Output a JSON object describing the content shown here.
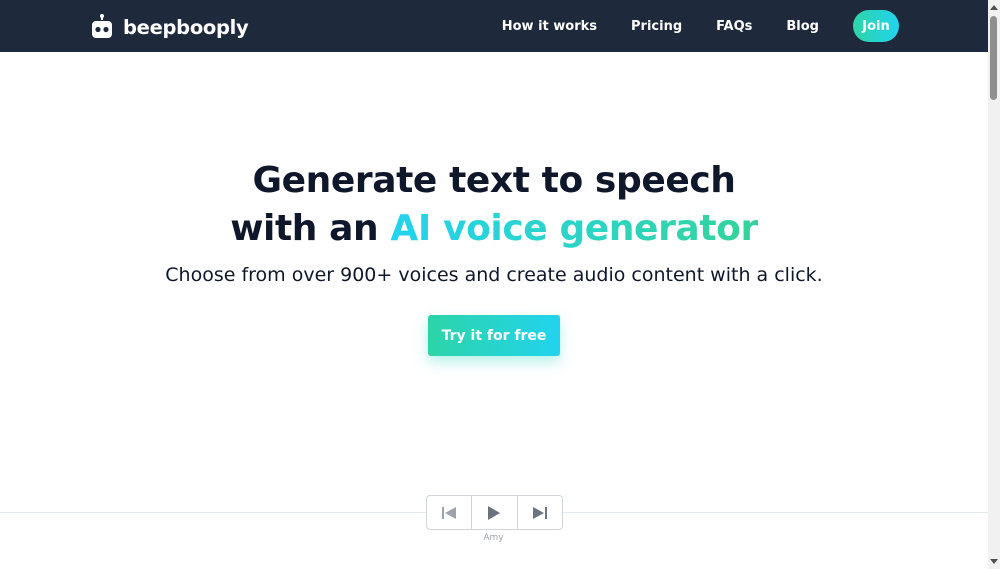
{
  "brand": {
    "name": "beepbooply"
  },
  "nav": {
    "links": [
      {
        "label": "How it works"
      },
      {
        "label": "Pricing"
      },
      {
        "label": "FAQs"
      },
      {
        "label": "Blog"
      }
    ],
    "join_label": "Join"
  },
  "hero": {
    "title_line1": "Generate text to speech",
    "title_line2_prefix": "with an ",
    "title_line2_highlight": "AI voice generator",
    "subtitle": "Choose from over 900+ voices and create audio content with a click.",
    "cta_label": "Try it for free"
  },
  "player": {
    "voice_name": "Amy",
    "controls": [
      {
        "icon": "skip-back-icon"
      },
      {
        "icon": "play-icon"
      },
      {
        "icon": "skip-forward-icon"
      }
    ]
  },
  "colors": {
    "navbar_bg": "#1e293b",
    "accent_start": "#2dd4a8",
    "accent_end": "#22d3ee",
    "heading": "#0f172a"
  }
}
